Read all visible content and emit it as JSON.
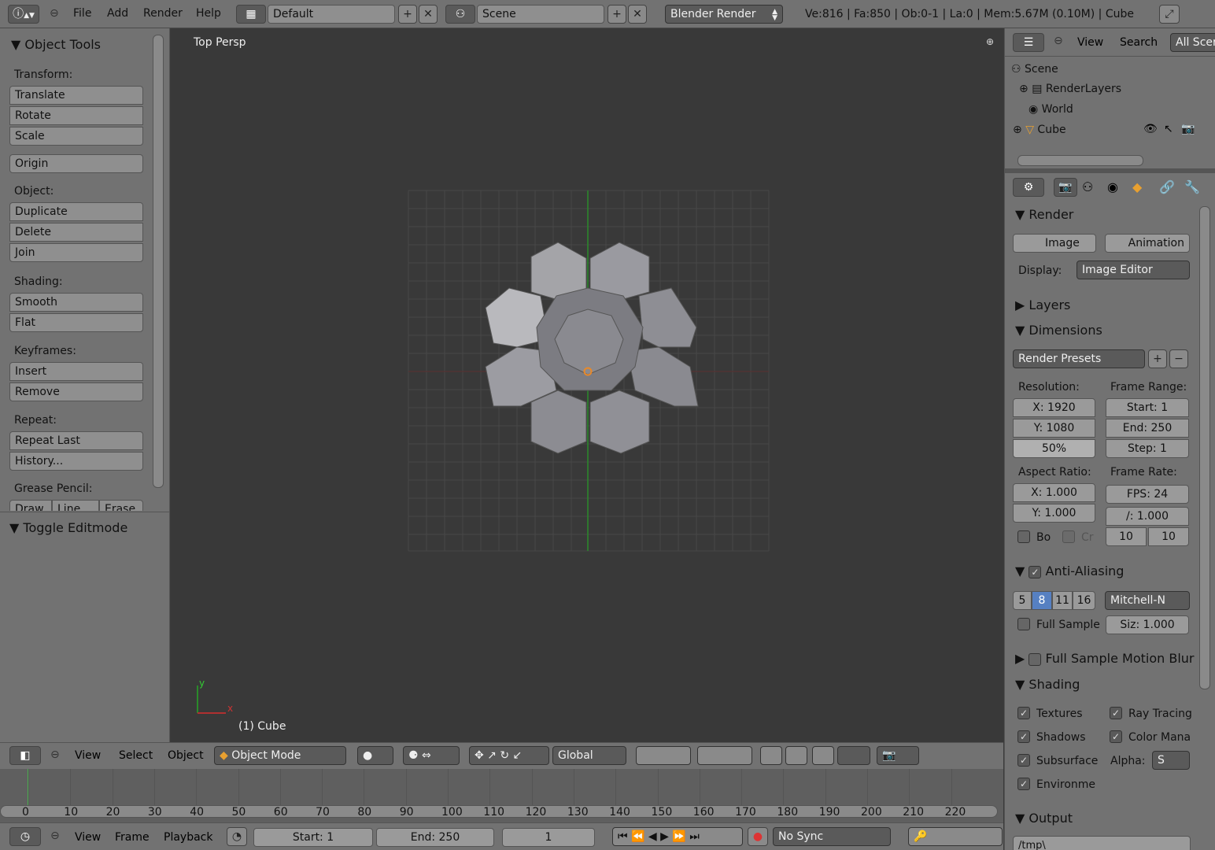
{
  "topbar": {
    "menus": [
      "File",
      "Add",
      "Render",
      "Help"
    ],
    "screen_layout": "Default",
    "scene": "Scene",
    "render_engine": "Blender Render",
    "stats": "Ve:816 | Fa:850 | Ob:0-1 | La:0 | Mem:5.67M (0.10M) | Cube"
  },
  "tool_panel": {
    "title": "Object Tools",
    "transform_label": "Transform:",
    "translate": "Translate",
    "rotate": "Rotate",
    "scale": "Scale",
    "origin": "Origin",
    "object_label": "Object:",
    "duplicate": "Duplicate",
    "delete": "Delete",
    "join": "Join",
    "shading_label": "Shading:",
    "smooth": "Smooth",
    "flat": "Flat",
    "keyframes_label": "Keyframes:",
    "insert": "Insert",
    "remove": "Remove",
    "repeat_label": "Repeat:",
    "repeat_last": "Repeat Last",
    "history": "History...",
    "grease_label": "Grease Pencil:",
    "draw": "Draw",
    "line": "Line",
    "erase": "Erase",
    "toggle_editmode": "Toggle Editmode"
  },
  "viewport": {
    "view_label": "Top Persp",
    "object_label": "(1) Cube",
    "axis_y": "y",
    "axis_x": "x"
  },
  "view3d_header": {
    "view": "View",
    "select": "Select",
    "object": "Object",
    "mode": "Object Mode",
    "orientation": "Global"
  },
  "timeline": {
    "ticks": [
      "0",
      "10",
      "20",
      "30",
      "40",
      "50",
      "60",
      "70",
      "80",
      "90",
      "100",
      "110",
      "120",
      "130",
      "140",
      "150",
      "160",
      "170",
      "180",
      "190",
      "200",
      "210",
      "220"
    ],
    "view": "View",
    "frame": "Frame",
    "playback": "Playback",
    "start": "Start: 1",
    "end": "End: 250",
    "current": "1",
    "sync": "No Sync"
  },
  "outliner": {
    "view": "View",
    "search": "Search",
    "filter": "All Scer",
    "items": [
      "Scene",
      "RenderLayers",
      "World",
      "Cube"
    ]
  },
  "properties": {
    "render_title": "Render",
    "image": "Image",
    "animation": "Animation",
    "display_label": "Display:",
    "display_value": "Image Editor",
    "layers": "Layers",
    "dimensions": "Dimensions",
    "presets": "Render Presets",
    "resolution_label": "Resolution:",
    "res_x": "X: 1920",
    "res_y": "Y: 1080",
    "res_pct": "50%",
    "frame_range_label": "Frame Range:",
    "start": "Start: 1",
    "end": "End: 250",
    "step": "Step: 1",
    "aspect_label": "Aspect Ratio:",
    "asp_x": "X: 1.000",
    "asp_y": "Y: 1.000",
    "frame_rate_label": "Frame Rate:",
    "fps": "FPS: 24",
    "fps_base": "/: 1.000",
    "bo": "Bo",
    "cr": "Cr",
    "old": "10",
    "new": "10",
    "aa_title": "Anti-Aliasing",
    "aa_samples": [
      "5",
      "8",
      "11",
      "16"
    ],
    "aa_filter": "Mitchell-N",
    "full_sample": "Full Sample",
    "aa_size": "Siz: 1.000",
    "motion_blur": "Full Sample Motion Blur",
    "shading_title": "Shading",
    "textures": "Textures",
    "ray_tracing": "Ray Tracing",
    "shadows": "Shadows",
    "color_mana": "Color Mana",
    "subsurface": "Subsurface",
    "alpha_label": "Alpha:",
    "alpha_value": "S",
    "environment": "Environme",
    "output_title": "Output",
    "output_path": "/tmp\\"
  },
  "colors": {
    "accent": "#5680c2",
    "grid": "#4a4a4a",
    "axis_x": "#8a3030",
    "axis_y": "#2a8a2a"
  }
}
